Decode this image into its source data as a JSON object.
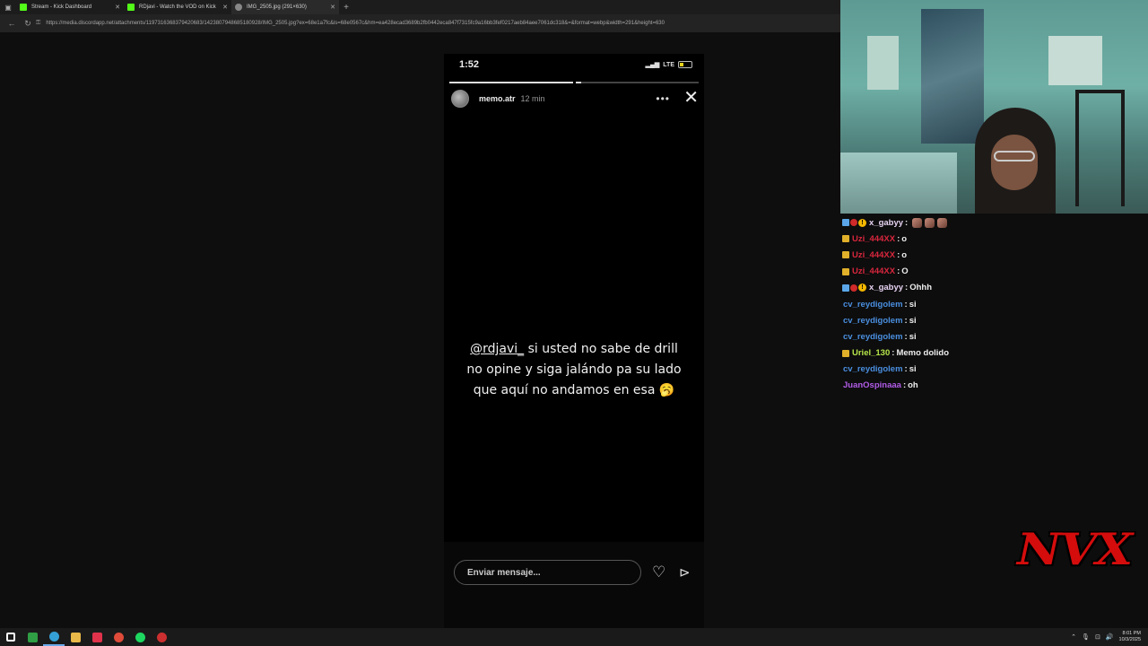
{
  "browser": {
    "tabs": [
      {
        "title": "Stream - Kick Dashboard",
        "favicon_color": "#53fc18"
      },
      {
        "title": "RDjavi - Watch the VOD on Kick",
        "favicon_color": "#53fc18"
      },
      {
        "title": "IMG_2505.jpg (291×630)",
        "favicon_color": "#888888"
      }
    ],
    "active_tab": 2,
    "url": "https://media.discordapp.net/attachments/1197316368379420683/1423807948685180928/IMG_2505.jpg?ex=68e1a7fc&is=68e0567c&hm=ea428ecad3689b2fb0442eca847f7315fc9a16bb3fef0217aeb84aee7061dc318&=&format=webp&width=291&height=630"
  },
  "story": {
    "time": "1:52",
    "network": "LTE",
    "battery_level": 0.35,
    "progress_segments": [
      1,
      0.05
    ],
    "username": "memo.atr",
    "ago": "12 min",
    "text_mention": "@rdjavi_",
    "text_body": " si usted no sabe de drill no opine y siga jalándo pa su lado que aquí no andamos en esa 🥱",
    "reply_placeholder": "Enviar mensaje..."
  },
  "chat": [
    {
      "badges": [
        "kick",
        "red",
        "warn"
      ],
      "user": "x_gabyy",
      "color": "#e7d3f2",
      "text": "",
      "emotes": 3
    },
    {
      "badges": [
        "gold"
      ],
      "user": "Uzi_444XX",
      "color": "#d7263d",
      "text": "o",
      "emotes": 0
    },
    {
      "badges": [
        "gold"
      ],
      "user": "Uzi_444XX",
      "color": "#d7263d",
      "text": "o",
      "emotes": 0
    },
    {
      "badges": [
        "gold"
      ],
      "user": "Uzi_444XX",
      "color": "#d7263d",
      "text": "O",
      "emotes": 0
    },
    {
      "badges": [
        "kick",
        "red",
        "warn"
      ],
      "user": "x_gabyy",
      "color": "#e7d3f2",
      "text": "Ohhh",
      "emotes": 0
    },
    {
      "badges": [],
      "user": "cv_reydigolem",
      "color": "#4a8fe0",
      "text": "si",
      "emotes": 0
    },
    {
      "badges": [],
      "user": "cv_reydigolem",
      "color": "#4a8fe0",
      "text": "si",
      "emotes": 0
    },
    {
      "badges": [],
      "user": "cv_reydigolem",
      "color": "#4a8fe0",
      "text": "si",
      "emotes": 0
    },
    {
      "badges": [
        "gold"
      ],
      "user": "Uriel_130",
      "color": "#b7e64a",
      "text": "Memo dolido",
      "emotes": 0
    },
    {
      "badges": [],
      "user": "cv_reydigolem",
      "color": "#4a8fe0",
      "text": "si",
      "emotes": 0
    },
    {
      "badges": [],
      "user": "JuanOspinaaa",
      "color": "#b15ce8",
      "text": "oh",
      "emotes": 0
    }
  ],
  "overlay_logo": "NVX",
  "taskbar": {
    "apps": [
      {
        "name": "windows-start-icon",
        "color": "#ffffff"
      },
      {
        "name": "terminal-icon",
        "color": "#2f9e44"
      },
      {
        "name": "edge-browser-icon",
        "color": "#35a0d6"
      },
      {
        "name": "file-explorer-icon",
        "color": "#e9b949"
      },
      {
        "name": "app-red-icon",
        "color": "#e0324b"
      },
      {
        "name": "chrome-icon",
        "color": "#e04b3a"
      },
      {
        "name": "spotify-icon",
        "color": "#1ed760"
      },
      {
        "name": "obs-icon",
        "color": "#cc2f2f"
      }
    ],
    "active_app": 2,
    "time": "8:01 PM",
    "date": "10/3/2025"
  }
}
